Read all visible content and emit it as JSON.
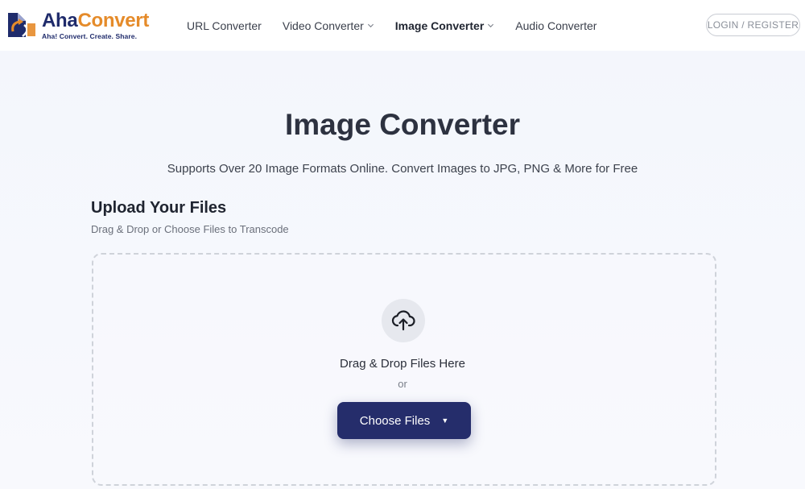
{
  "header": {
    "logo": {
      "name_part1": "Aha",
      "name_part2": "Convert",
      "tagline": "Aha! Convert. Create. Share."
    },
    "nav": [
      {
        "label": "URL Converter",
        "has_dropdown": false,
        "active": false
      },
      {
        "label": "Video Converter",
        "has_dropdown": true,
        "active": false
      },
      {
        "label": "Image Converter",
        "has_dropdown": true,
        "active": true
      },
      {
        "label": "Audio Converter",
        "has_dropdown": false,
        "active": false
      }
    ],
    "login_label": "LOGIN / REGISTER"
  },
  "hero": {
    "title": "Image Converter",
    "subtitle": "Supports Over 20 Image Formats Online. Convert Images to JPG, PNG & More for Free"
  },
  "upload": {
    "title": "Upload Your Files",
    "subtitle": "Drag & Drop or Choose Files to Transcode",
    "drop_text": "Drag & Drop Files Here",
    "or_text": "or",
    "button_label": "Choose Files",
    "button_caret": "▼"
  },
  "colors": {
    "brand_navy": "#252d6b",
    "brand_orange": "#e58b2a",
    "page_bg": "#f4f7fc"
  },
  "icons": {
    "upload": "cloud-upload-icon",
    "nav_chevron": "chevron-down-icon",
    "button_caret": "caret-down-icon"
  }
}
